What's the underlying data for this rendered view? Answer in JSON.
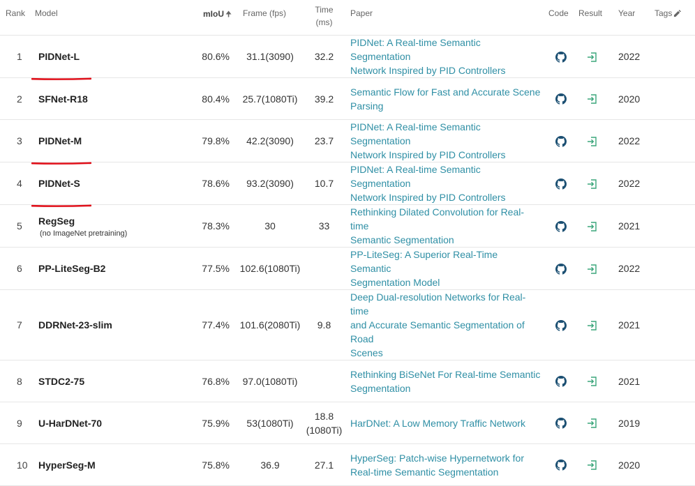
{
  "headers": {
    "rank": "Rank",
    "model": "Model",
    "miou": "mIoU",
    "frame": "Frame (fps)",
    "time_line1": "Time",
    "time_line2": "(ms)",
    "paper": "Paper",
    "code": "Code",
    "result": "Result",
    "year": "Year",
    "tags": "Tags"
  },
  "rows": [
    {
      "rank": "1",
      "model": "PIDNet-L",
      "sub": "",
      "miou": "80.6%",
      "frame": "31.1(3090)",
      "time": "32.2",
      "time2": "",
      "paper": [
        "PIDNet: A Real-time Semantic Segmentation",
        "Network Inspired by PID Controllers"
      ],
      "year": "2022",
      "underlined": true
    },
    {
      "rank": "2",
      "model": "SFNet-R18",
      "sub": "",
      "miou": "80.4%",
      "frame": "25.7(1080Ti)",
      "time": "39.2",
      "time2": "",
      "paper": [
        "Semantic Flow for Fast and Accurate Scene",
        "Parsing"
      ],
      "year": "2020",
      "underlined": false
    },
    {
      "rank": "3",
      "model": "PIDNet-M",
      "sub": "",
      "miou": "79.8%",
      "frame": "42.2(3090)",
      "time": "23.7",
      "time2": "",
      "paper": [
        "PIDNet: A Real-time Semantic Segmentation",
        "Network Inspired by PID Controllers"
      ],
      "year": "2022",
      "underlined": true
    },
    {
      "rank": "4",
      "model": "PIDNet-S",
      "sub": "",
      "miou": "78.6%",
      "frame": "93.2(3090)",
      "time": "10.7",
      "time2": "",
      "paper": [
        "PIDNet: A Real-time Semantic Segmentation",
        "Network Inspired by PID Controllers"
      ],
      "year": "2022",
      "underlined": true
    },
    {
      "rank": "5",
      "model": "RegSeg",
      "sub": "(no ImageNet pretraining)",
      "miou": "78.3%",
      "frame": "30",
      "time": "33",
      "time2": "",
      "paper": [
        "Rethinking Dilated Convolution for Real-time",
        "Semantic Segmentation"
      ],
      "year": "2021",
      "underlined": false
    },
    {
      "rank": "6",
      "model": "PP-LiteSeg-B2",
      "sub": "",
      "miou": "77.5%",
      "frame": "102.6(1080Ti)",
      "time": "",
      "time2": "",
      "paper": [
        "PP-LiteSeg: A Superior Real-Time Semantic",
        "Segmentation Model"
      ],
      "year": "2022",
      "underlined": false
    },
    {
      "rank": "7",
      "model": "DDRNet-23-slim",
      "sub": "",
      "miou": "77.4%",
      "frame": "101.6(2080Ti)",
      "time": "9.8",
      "time2": "",
      "paper": [
        "Deep Dual-resolution Networks for Real-time",
        "and Accurate Semantic Segmentation of Road",
        "Scenes"
      ],
      "year": "2021",
      "underlined": false
    },
    {
      "rank": "8",
      "model": "STDC2-75",
      "sub": "",
      "miou": "76.8%",
      "frame": "97.0(1080Ti)",
      "time": "",
      "time2": "",
      "paper": [
        "Rethinking BiSeNet For Real-time Semantic",
        "Segmentation"
      ],
      "year": "2021",
      "underlined": false
    },
    {
      "rank": "9",
      "model": "U-HarDNet-70",
      "sub": "",
      "miou": "75.9%",
      "frame": "53(1080Ti)",
      "time": "18.8",
      "time2": "(1080Ti)",
      "paper": [
        "HarDNet: A Low Memory Traffic Network"
      ],
      "year": "2019",
      "underlined": false
    },
    {
      "rank": "10",
      "model": "HyperSeg-M",
      "sub": "",
      "miou": "75.8%",
      "frame": "36.9",
      "time": "27.1",
      "time2": "",
      "paper": [
        "HyperSeg: Patch-wise Hypernetwork for",
        "Real-time Semantic Segmentation"
      ],
      "year": "2020",
      "underlined": false
    }
  ],
  "icons": {
    "code": "github-icon",
    "result": "result-icon",
    "tags": "edit-icon",
    "sort": "sort-up-icon"
  },
  "colors": {
    "link": "#2f8fa5",
    "result_icon": "#3aa57a",
    "underline": "#e0101a",
    "github": "#1b4f72"
  }
}
